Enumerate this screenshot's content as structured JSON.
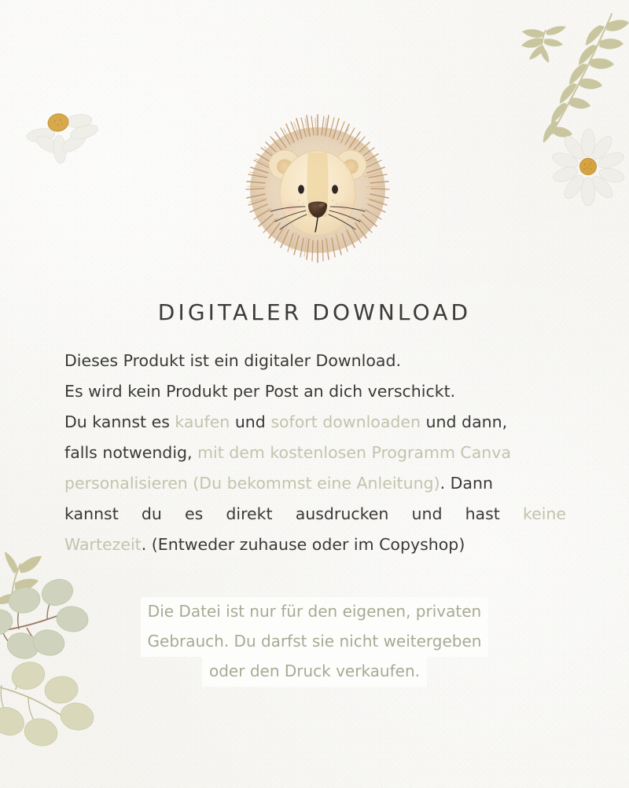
{
  "document": {
    "title": "Digitaler Download",
    "language": "de",
    "background_color": "#f8f7f4"
  },
  "heading": {
    "text": "DIGITALER DOWNLOAD",
    "color": "#3c3b39"
  },
  "colors": {
    "text_dark": "#3a3936",
    "text_sage": "#c4c3ac",
    "note_text": "#a9a995",
    "highlight_band": "#fdfdfb",
    "branch_olive": "#c9c69f",
    "eucalyptus_green": "#c9cdb4",
    "eucalyptus_pale": "#d7d7bd",
    "daisy_petal": "#efeee9",
    "daisy_center": "#d5a341",
    "mane_light": "#e2c49c",
    "mane_mid": "#c9a272",
    "mane_dark": "#b08a5e",
    "face_cream": "#f6e6c8",
    "face_stripe": "#edd39c",
    "nose_dark": "#4a3425",
    "cheek_blush": "#f0cbb6"
  },
  "body_copy": {
    "lines": [
      {
        "justified": false,
        "segments": [
          {
            "text": "Dieses Produkt ist ein digitaler Download.",
            "tone": "dark"
          }
        ]
      },
      {
        "justified": false,
        "segments": [
          {
            "text": "Es wird kein Produkt per Post an dich verschickt.",
            "tone": "dark"
          }
        ]
      },
      {
        "justified": false,
        "segments": [
          {
            "text": "Du kannst es ",
            "tone": "dark"
          },
          {
            "text": "kaufen",
            "tone": "sage"
          },
          {
            "text": " und ",
            "tone": "dark"
          },
          {
            "text": "sofort downloaden",
            "tone": "sage"
          },
          {
            "text": " und dann,",
            "tone": "dark"
          }
        ]
      },
      {
        "justified": false,
        "segments": [
          {
            "text": "falls notwendig, ",
            "tone": "dark"
          },
          {
            "text": "mit dem kostenlosen Programm Canva",
            "tone": "sage"
          }
        ]
      },
      {
        "justified": false,
        "segments": [
          {
            "text": "personalisieren (Du bekommst eine Anleitung)",
            "tone": "sage"
          },
          {
            "text": ".   Dann",
            "tone": "dark"
          }
        ]
      },
      {
        "justified": true,
        "words": [
          {
            "text": "kannst",
            "tone": "dark"
          },
          {
            "text": "du",
            "tone": "dark"
          },
          {
            "text": "es",
            "tone": "dark"
          },
          {
            "text": "direkt",
            "tone": "dark"
          },
          {
            "text": "ausdrucken",
            "tone": "dark"
          },
          {
            "text": "und",
            "tone": "dark"
          },
          {
            "text": "hast",
            "tone": "dark"
          },
          {
            "text": "keine",
            "tone": "sage"
          }
        ]
      },
      {
        "justified": false,
        "segments": [
          {
            "text": "Wartezeit",
            "tone": "sage"
          },
          {
            "text": ". (Entweder zuhause oder im Copyshop)",
            "tone": "dark"
          }
        ]
      }
    ]
  },
  "license_note": {
    "lines": [
      "Die Datei ist nur für den eigenen, privaten",
      "Gebrauch. Du darfst sie nicht weitergeben",
      "oder den Druck verkaufen."
    ]
  },
  "illustrations": {
    "lion": "lion-head-watercolor",
    "branch_top_right": "olive-branch-sprigs",
    "daisy_top_right": "white-daisy-flower",
    "daisy_top_left": "white-daisy-partial",
    "eucalyptus_bottom_left": "eucalyptus-branches"
  }
}
